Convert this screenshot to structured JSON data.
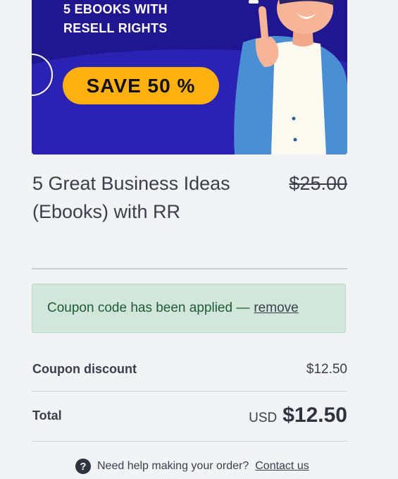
{
  "banner": {
    "line1": "5 EBOOKS WITH",
    "line2": "RESELL RIGHTS",
    "badge": "SAVE 50 %"
  },
  "product": {
    "title": "5 Great Business Ideas (Ebooks) with RR",
    "original_price": "$25.00"
  },
  "coupon": {
    "message": "Coupon code has been applied —",
    "remove_label": "remove"
  },
  "summary": {
    "discount_label": "Coupon discount",
    "discount_value": "$12.50",
    "total_label": "Total",
    "total_currency": "USD",
    "total_value": "$12.50"
  },
  "help": {
    "icon": "question-icon",
    "text": "Need help making your order?",
    "link": "Contact us"
  },
  "colors": {
    "banner_bg": "#2b22b4",
    "badge_bg": "#ffb10f",
    "coupon_bg": "#d2e6dc",
    "coupon_text": "#1d5b3a"
  }
}
